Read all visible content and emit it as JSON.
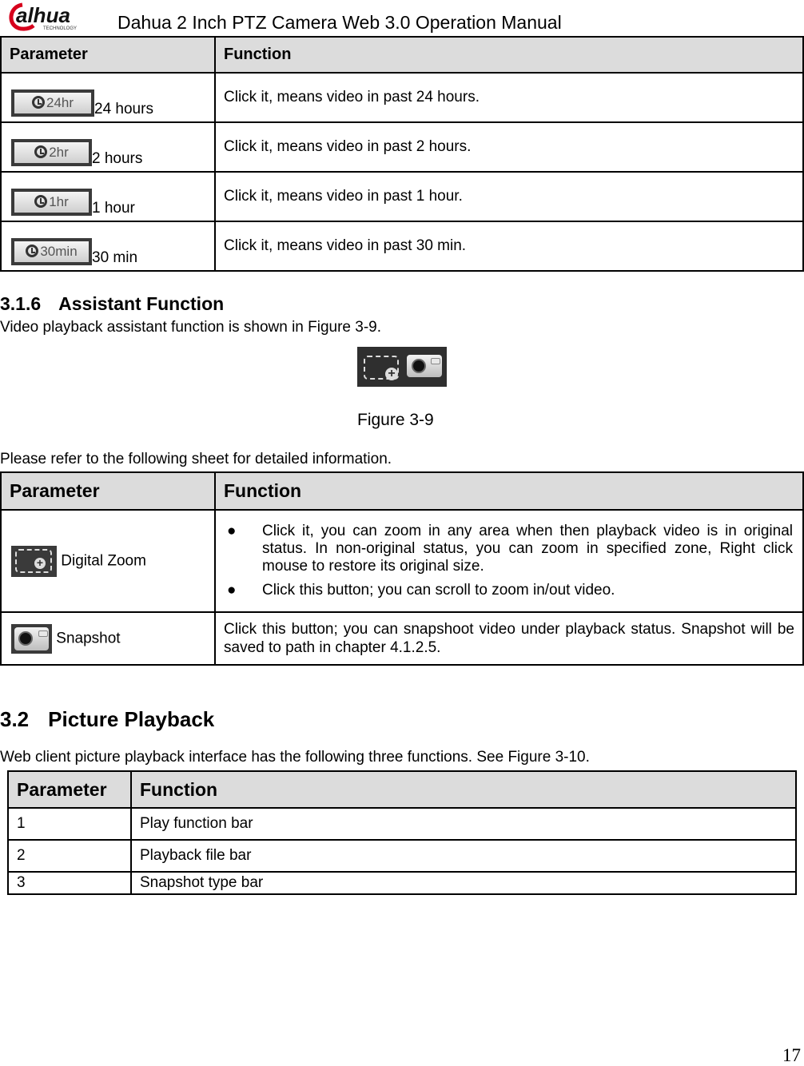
{
  "header": {
    "logo_text": "alhua",
    "logo_sub": "TECHNOLOGY",
    "title": "Dahua 2 Inch PTZ Camera Web 3.0 Operation Manual"
  },
  "table_time": {
    "headers": [
      "Parameter",
      "Function"
    ],
    "rows": [
      {
        "icon_label": "24hr",
        "param": "24 hours",
        "function": "Click it, means video in past 24 hours."
      },
      {
        "icon_label": "2hr",
        "param": "2 hours",
        "function": "Click it, means video in past 2 hours."
      },
      {
        "icon_label": "1hr",
        "param": "1 hour",
        "function": "Click it, means video in past 1 hour."
      },
      {
        "icon_label": "30min",
        "param": "30 min",
        "function": "Click it, means video in past 30 min."
      }
    ]
  },
  "section_316": {
    "number": "3.1.6",
    "title": "Assistant Function",
    "intro": "Video playback assistant function is shown in Figure 3-9.",
    "figure_caption": "Figure 3-9",
    "sheet_note": "Please refer to the following sheet for detailed information."
  },
  "table_assist": {
    "headers": [
      "Parameter",
      "Function"
    ],
    "rows": [
      {
        "param": "Digital Zoom",
        "icon": "digital-zoom-icon",
        "bullets": [
          "Click it, you can zoom in any area when then playback video is in original status. In non-original status, you can zoom in specified zone, Right click mouse to restore its original size.",
          "Click this button; you can scroll to zoom in/out video."
        ]
      },
      {
        "param": "Snapshot",
        "icon": "snapshot-camera-icon",
        "function": "Click this button; you can snapshoot video under playback status. Snapshot will be saved to path in chapter 4.1.2.5."
      }
    ]
  },
  "section_32": {
    "number": "3.2",
    "title": "Picture Playback",
    "intro": "Web client picture playback interface has the following three functions. See Figure 3-10."
  },
  "table_picture": {
    "headers": [
      "Parameter",
      "Function"
    ],
    "rows": [
      {
        "param": "1",
        "function": "Play function bar"
      },
      {
        "param": "2",
        "function": "Playback file bar"
      },
      {
        "param": "3",
        "function": "Snapshot type bar"
      }
    ]
  },
  "footer": {
    "page_number": "17"
  }
}
